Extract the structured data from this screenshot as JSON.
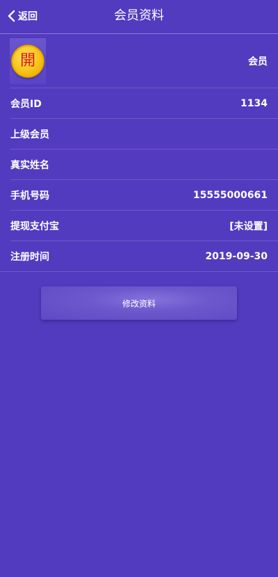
{
  "header": {
    "back_label": "返回",
    "title": "会员资料"
  },
  "profile": {
    "avatar_char": "開",
    "member_type": "会员",
    "rows": [
      {
        "label": "会员ID",
        "value": "1134"
      },
      {
        "label": "上级会员",
        "value": ""
      },
      {
        "label": "真实姓名",
        "value": ""
      },
      {
        "label": "手机号码",
        "value": "15555000661"
      },
      {
        "label": "提现支付宝",
        "value": "[未设置]"
      },
      {
        "label": "注册时间",
        "value": "2019-09-30"
      }
    ]
  },
  "actions": {
    "edit_label": "修改资料"
  },
  "colors": {
    "background": "#533bbf",
    "divider": "#6e59c8",
    "avatar_gold": "#f7c51a",
    "avatar_char": "#d8161b"
  }
}
